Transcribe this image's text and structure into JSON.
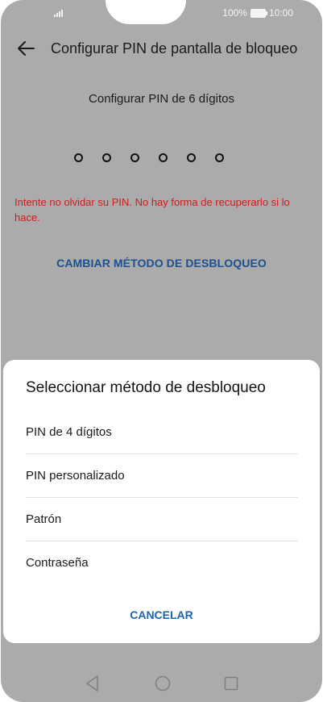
{
  "status_bar": {
    "battery": "100%",
    "time": "10:00"
  },
  "header": {
    "title": "Configurar PIN de pantalla de bloqueo"
  },
  "pin_setup": {
    "subtitle": "Configurar PIN de 6 dígitos",
    "dots": 6,
    "warning": "Intente no olvidar su PIN. No hay forma de recuperarlo si lo hace.",
    "change_method_label": "CAMBIAR MÉTODO DE DESBLOQUEO"
  },
  "sheet": {
    "title": "Seleccionar método de desbloqueo",
    "options": [
      "PIN de 4 dígitos",
      "PIN personalizado",
      "Patrón",
      "Contraseña"
    ],
    "cancel_label": "CANCELAR"
  },
  "colors": {
    "accent": "#1c62b3",
    "warning": "#cc1e1e",
    "scrim": "#ababab"
  }
}
